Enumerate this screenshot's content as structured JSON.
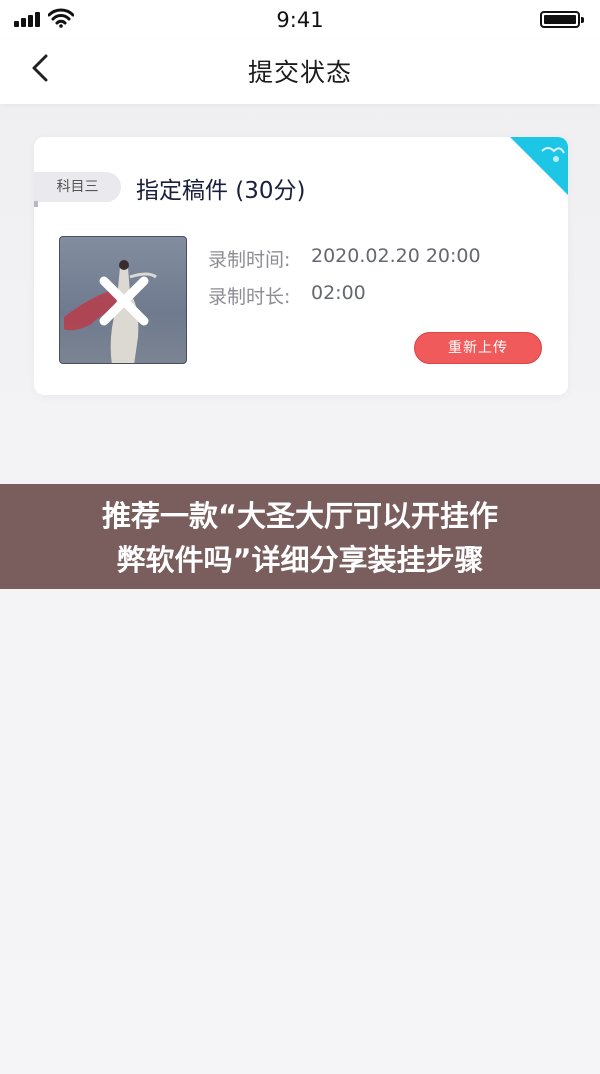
{
  "status_bar": {
    "time": "9:41",
    "icons": [
      "signal-icon",
      "wifi-icon",
      "battery-icon"
    ]
  },
  "nav": {
    "back_icon": "chevron-left-icon",
    "title": "提交状态"
  },
  "card": {
    "subject_tag": "科目三",
    "title": "指定稿件 (30分)",
    "record_time_label": "录制时间:",
    "record_time_value": "2020.02.20 20:00",
    "record_duration_label": "录制时长:",
    "record_duration_value": "02:00",
    "reupload_label": "重新上传",
    "thumbnail_icon": "close-icon",
    "colors": {
      "accent_red": "#f05a5a",
      "ribbon_cyan": "#1ec6e6"
    }
  },
  "banner": {
    "line1": "推荐一款“大圣大厅可以开挂作",
    "line2": "弊软件吗”详细分享装挂步骤"
  }
}
